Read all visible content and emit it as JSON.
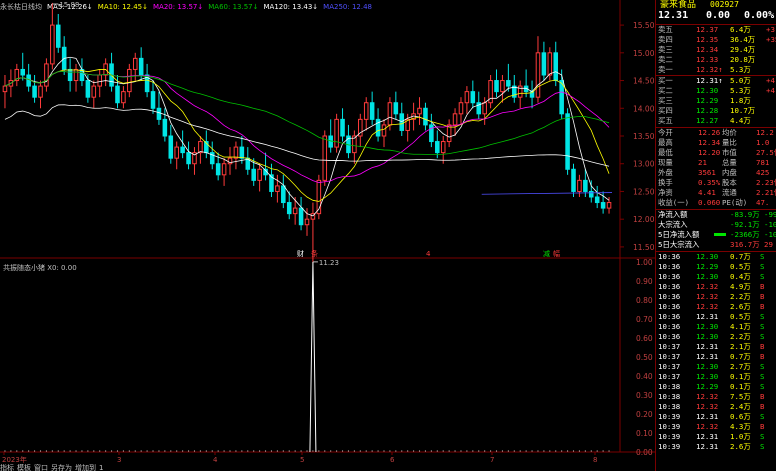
{
  "indicator_bar": {
    "stock_label": "永长枯日线均",
    "items": [
      {
        "label": "MA5: 12.26↓",
        "color": "#ffffff"
      },
      {
        "label": "MA10: 12.45↓",
        "color": "#ffff00"
      },
      {
        "label": "MA20: 13.57↓",
        "color": "#ff00ff"
      },
      {
        "label": "MA60: 13.57↓",
        "color": "#00c000"
      },
      {
        "label": "MA120: 13.43↓",
        "color": "#ffffff"
      },
      {
        "label": "MA250: 12.48",
        "color": "#5050ff"
      }
    ]
  },
  "price_chart": {
    "y_ticks": [
      "15.50",
      "15.00",
      "14.50",
      "14.00",
      "13.50",
      "13.00",
      "12.50",
      "12.00",
      "11.50"
    ],
    "high_label": "15.88",
    "low_label": "11.23",
    "markers": [
      {
        "text": "财",
        "color": "#ffffff"
      },
      {
        "text": "条",
        "color": "#ff3b3b"
      },
      {
        "text": "4",
        "color": "#ff3b3b"
      },
      {
        "text": "减",
        "color": "#00e600"
      },
      {
        "text": "幅",
        "color": "#ff3b3b"
      }
    ]
  },
  "sub_chart": {
    "title": "共振随态小猪 X0: 0.00",
    "y_ticks": [
      "1.00",
      "0.90",
      "0.80",
      "0.70",
      "0.60",
      "0.50",
      "0.40",
      "0.30",
      "0.20",
      "0.10",
      "0.00"
    ]
  },
  "x_axis": {
    "labels": [
      "2023年",
      "3",
      "4",
      "5",
      "6",
      "7",
      "8"
    ]
  },
  "bottom_bar": {
    "labels": [
      "指标",
      "模板",
      "窗口",
      "另存为",
      "增加到",
      "1"
    ]
  },
  "right_panel": {
    "header_name": "豪来食品",
    "header_code": "002927",
    "price": "12.31",
    "change": "0.00",
    "change_pct": "0.00%",
    "order_book": [
      {
        "label": "卖五",
        "price": "12.37",
        "vol": "6.4万",
        "extra": "+3"
      },
      {
        "label": "卖四",
        "price": "12.35",
        "vol": "36.4万",
        "extra": "+35"
      },
      {
        "label": "卖三",
        "price": "12.34",
        "vol": "29.4万",
        "extra": ""
      },
      {
        "label": "卖二",
        "price": "12.33",
        "vol": "20.8万",
        "extra": ""
      },
      {
        "label": "卖一",
        "price": "12.32↑",
        "vol": "5.3万",
        "extra": ""
      },
      {
        "label": "买一",
        "price": "12.31↑",
        "vol": "5.0万",
        "extra": "+4"
      },
      {
        "label": "买二",
        "price": "12.30",
        "vol": "5.3万",
        "extra": "+4"
      },
      {
        "label": "买三",
        "price": "12.29",
        "vol": "1.8万",
        "extra": ""
      },
      {
        "label": "买四",
        "price": "12.28",
        "vol": "10.7万",
        "extra": ""
      },
      {
        "label": "买五",
        "price": "12.27",
        "vol": "4.4万",
        "extra": ""
      }
    ],
    "stats": [
      {
        "l1": "今开",
        "v1": "12.26",
        "l2": "均价",
        "v2": "12.2"
      },
      {
        "l1": "最高",
        "v1": "12.34",
        "l2": "量比",
        "v2": "1.0"
      },
      {
        "l1": "最低",
        "v1": "12.20",
        "l2": "市值",
        "v2": "27.5亿"
      },
      {
        "l1": "现量",
        "v1": "21",
        "l2": "总量",
        "v2": "781"
      },
      {
        "l1": "外盘",
        "v1": "3561",
        "l2": "内盘",
        "v2": "425"
      },
      {
        "l1": "换手",
        "v1": "0.35%",
        "l2": "股本",
        "v2": "2.23亿"
      },
      {
        "l1": "净资",
        "v1": "4.41",
        "l2": "流通",
        "v2": "2.21亿"
      },
      {
        "l1": "收益(一)",
        "v1": "0.060",
        "l2": "PE(动)",
        "v2": "47."
      }
    ],
    "flows": [
      {
        "label": "净流入额",
        "value": "-83.9万",
        "extra": "-99"
      },
      {
        "label": "大宗流入",
        "value": "-92.1万",
        "extra": "-10"
      },
      {
        "label": "5日净流入额",
        "value": "-2366万",
        "extra": "-10"
      },
      {
        "label": "5日大宗流入",
        "value": "316.7万",
        "extra": "29"
      }
    ],
    "ticks": [
      {
        "t": "10:36",
        "p": "12.30",
        "v": "0.7万",
        "d": "S"
      },
      {
        "t": "10:36",
        "p": "12.29",
        "v": "0.5万",
        "d": "S"
      },
      {
        "t": "10:36",
        "p": "12.30",
        "v": "0.4万",
        "d": "S"
      },
      {
        "t": "10:36",
        "p": "12.32",
        "v": "4.9万",
        "d": "B"
      },
      {
        "t": "10:36",
        "p": "12.32",
        "v": "2.2万",
        "d": "B"
      },
      {
        "t": "10:36",
        "p": "12.32",
        "v": "2.6万",
        "d": "B"
      },
      {
        "t": "10:36",
        "p": "12.31",
        "v": "0.5万",
        "d": "S"
      },
      {
        "t": "10:36",
        "p": "12.30",
        "v": "4.1万",
        "d": "S"
      },
      {
        "t": "10:36",
        "p": "12.30",
        "v": "2.2万",
        "d": "S"
      },
      {
        "t": "10:37",
        "p": "12.31",
        "v": "2.1万",
        "d": "B"
      },
      {
        "t": "10:37",
        "p": "12.31",
        "v": "0.7万",
        "d": "B"
      },
      {
        "t": "10:37",
        "p": "12.30",
        "v": "2.7万",
        "d": "S"
      },
      {
        "t": "10:37",
        "p": "12.30",
        "v": "0.1万",
        "d": "S"
      },
      {
        "t": "10:38",
        "p": "12.29",
        "v": "0.1万",
        "d": "S"
      },
      {
        "t": "10:38",
        "p": "12.32",
        "v": "7.5万",
        "d": "B"
      },
      {
        "t": "10:38",
        "p": "12.32",
        "v": "2.4万",
        "d": "B"
      },
      {
        "t": "10:39",
        "p": "12.31",
        "v": "0.6万",
        "d": "S"
      },
      {
        "t": "10:39",
        "p": "12.32",
        "v": "4.3万",
        "d": "B"
      },
      {
        "t": "10:39",
        "p": "12.31",
        "v": "1.0万",
        "d": "S"
      },
      {
        "t": "10:39",
        "p": "12.31",
        "v": "2.6万",
        "d": "S"
      }
    ]
  },
  "colors": {
    "up": "#ff3b3b",
    "down": "#00e5e5",
    "border": "#7a0000",
    "ma5": "#ffffff",
    "ma10": "#ffff00",
    "ma20": "#ff00ff",
    "ma60": "#00c000",
    "ma250": "#5050ff"
  },
  "chart_data": {
    "type": "candlestick",
    "title": "",
    "y_range": [
      11.3,
      15.7
    ],
    "sub_y_range": [
      0,
      1
    ],
    "series": [
      {
        "name": "MA5",
        "color": "#ffffff"
      },
      {
        "name": "MA10",
        "color": "#ffff00"
      },
      {
        "name": "MA20",
        "color": "#ff00ff"
      },
      {
        "name": "MA60",
        "color": "#00c000"
      },
      {
        "name": "MA120",
        "color": "#ffffff"
      },
      {
        "name": "MA250",
        "color": "#5050ff"
      }
    ],
    "candles": [
      [
        14.3,
        14.6,
        14.0,
        14.4
      ],
      [
        14.4,
        14.7,
        14.2,
        14.5
      ],
      [
        14.5,
        14.8,
        14.4,
        14.7
      ],
      [
        14.7,
        15.0,
        14.5,
        14.6
      ],
      [
        14.6,
        14.8,
        14.3,
        14.4
      ],
      [
        14.4,
        14.6,
        14.1,
        14.2
      ],
      [
        14.2,
        14.5,
        14.0,
        14.4
      ],
      [
        14.4,
        14.9,
        14.3,
        14.8
      ],
      [
        14.8,
        15.9,
        14.7,
        15.5
      ],
      [
        15.5,
        15.7,
        15.0,
        15.1
      ],
      [
        15.1,
        15.3,
        14.6,
        14.7
      ],
      [
        14.7,
        14.9,
        14.3,
        14.5
      ],
      [
        14.5,
        14.8,
        14.3,
        14.7
      ],
      [
        14.7,
        14.9,
        14.4,
        14.5
      ],
      [
        14.5,
        14.6,
        14.1,
        14.2
      ],
      [
        14.2,
        14.5,
        14.0,
        14.4
      ],
      [
        14.4,
        14.7,
        14.2,
        14.6
      ],
      [
        14.6,
        14.9,
        14.4,
        14.8
      ],
      [
        14.8,
        15.0,
        14.3,
        14.4
      ],
      [
        14.4,
        14.6,
        14.0,
        14.1
      ],
      [
        14.1,
        14.4,
        14.0,
        14.3
      ],
      [
        14.3,
        14.8,
        14.2,
        14.7
      ],
      [
        14.7,
        15.0,
        14.5,
        14.9
      ],
      [
        14.9,
        15.1,
        14.5,
        14.6
      ],
      [
        14.6,
        14.8,
        14.2,
        14.3
      ],
      [
        14.3,
        14.5,
        13.9,
        14.0
      ],
      [
        14.0,
        14.3,
        13.7,
        13.8
      ],
      [
        13.8,
        14.0,
        13.4,
        13.5
      ],
      [
        13.5,
        13.7,
        13.0,
        13.1
      ],
      [
        13.1,
        13.4,
        12.9,
        13.3
      ],
      [
        13.3,
        13.6,
        13.1,
        13.2
      ],
      [
        13.2,
        13.4,
        12.9,
        13.0
      ],
      [
        13.0,
        13.3,
        12.8,
        13.2
      ],
      [
        13.2,
        13.5,
        13.0,
        13.4
      ],
      [
        13.4,
        13.6,
        13.1,
        13.2
      ],
      [
        13.2,
        13.4,
        12.9,
        13.0
      ],
      [
        13.0,
        13.2,
        12.7,
        12.8
      ],
      [
        12.8,
        13.1,
        12.6,
        13.0
      ],
      [
        13.0,
        13.3,
        12.8,
        13.1
      ],
      [
        13.1,
        13.4,
        12.9,
        13.3
      ],
      [
        13.3,
        13.5,
        13.0,
        13.1
      ],
      [
        13.1,
        13.3,
        12.8,
        12.9
      ],
      [
        12.9,
        13.1,
        12.6,
        12.7
      ],
      [
        12.7,
        13.0,
        12.5,
        12.9
      ],
      [
        12.9,
        13.2,
        12.7,
        12.8
      ],
      [
        12.8,
        13.0,
        12.4,
        12.5
      ],
      [
        12.5,
        12.8,
        12.3,
        12.6
      ],
      [
        12.6,
        12.8,
        12.2,
        12.3
      ],
      [
        12.3,
        12.5,
        12.0,
        12.1
      ],
      [
        12.1,
        12.4,
        11.9,
        12.2
      ],
      [
        12.2,
        12.4,
        11.8,
        11.9
      ],
      [
        11.9,
        12.2,
        11.7,
        12.0
      ],
      [
        12.0,
        12.3,
        11.2,
        12.1
      ],
      [
        12.1,
        12.8,
        12.0,
        12.7
      ],
      [
        12.7,
        13.6,
        12.6,
        13.5
      ],
      [
        13.5,
        13.8,
        13.2,
        13.3
      ],
      [
        13.3,
        13.9,
        13.2,
        13.8
      ],
      [
        13.8,
        14.0,
        13.4,
        13.5
      ],
      [
        13.5,
        13.7,
        13.1,
        13.2
      ],
      [
        13.2,
        13.6,
        13.0,
        13.5
      ],
      [
        13.5,
        13.9,
        13.3,
        13.8
      ],
      [
        13.8,
        14.2,
        13.6,
        14.1
      ],
      [
        14.1,
        14.3,
        13.7,
        13.8
      ],
      [
        13.8,
        14.0,
        13.4,
        13.5
      ],
      [
        13.5,
        13.8,
        13.3,
        13.7
      ],
      [
        13.7,
        14.2,
        13.6,
        14.1
      ],
      [
        14.1,
        14.3,
        13.8,
        13.9
      ],
      [
        13.9,
        14.1,
        13.5,
        13.6
      ],
      [
        13.6,
        13.9,
        13.4,
        13.8
      ],
      [
        13.8,
        14.1,
        13.6,
        13.9
      ],
      [
        13.9,
        14.2,
        13.7,
        14.0
      ],
      [
        14.0,
        14.1,
        13.6,
        13.7
      ],
      [
        13.7,
        13.9,
        13.3,
        13.4
      ],
      [
        13.4,
        13.6,
        13.1,
        13.2
      ],
      [
        13.2,
        13.5,
        13.0,
        13.4
      ],
      [
        13.4,
        13.8,
        13.3,
        13.7
      ],
      [
        13.7,
        14.0,
        13.5,
        13.9
      ],
      [
        13.9,
        14.2,
        13.7,
        14.1
      ],
      [
        14.1,
        14.4,
        13.9,
        14.3
      ],
      [
        14.3,
        14.5,
        14.0,
        14.1
      ],
      [
        14.1,
        14.3,
        13.8,
        13.9
      ],
      [
        13.9,
        14.2,
        13.7,
        14.1
      ],
      [
        14.1,
        14.6,
        14.0,
        14.5
      ],
      [
        14.5,
        14.7,
        14.2,
        14.3
      ],
      [
        14.3,
        14.6,
        14.1,
        14.5
      ],
      [
        14.5,
        14.8,
        14.3,
        14.4
      ],
      [
        14.4,
        14.6,
        14.1,
        14.2
      ],
      [
        14.2,
        14.5,
        14.0,
        14.4
      ],
      [
        14.4,
        14.7,
        14.2,
        14.3
      ],
      [
        14.3,
        14.5,
        14.0,
        14.2
      ],
      [
        14.2,
        15.3,
        14.1,
        15.0
      ],
      [
        15.0,
        15.2,
        14.5,
        14.6
      ],
      [
        14.6,
        15.1,
        14.5,
        15.0
      ],
      [
        15.0,
        15.2,
        14.4,
        14.5
      ],
      [
        14.5,
        14.7,
        13.8,
        13.9
      ],
      [
        13.9,
        14.0,
        12.8,
        12.9
      ],
      [
        12.9,
        13.0,
        12.4,
        12.5
      ],
      [
        12.5,
        12.8,
        12.4,
        12.7
      ],
      [
        12.7,
        12.9,
        12.4,
        12.5
      ],
      [
        12.5,
        12.7,
        12.3,
        12.4
      ],
      [
        12.4,
        12.6,
        12.2,
        12.3
      ],
      [
        12.3,
        12.5,
        12.1,
        12.2
      ],
      [
        12.2,
        12.4,
        12.1,
        12.3
      ]
    ],
    "sub_values_note": "single spike to 1.00 near index 52, otherwise 0.00"
  }
}
